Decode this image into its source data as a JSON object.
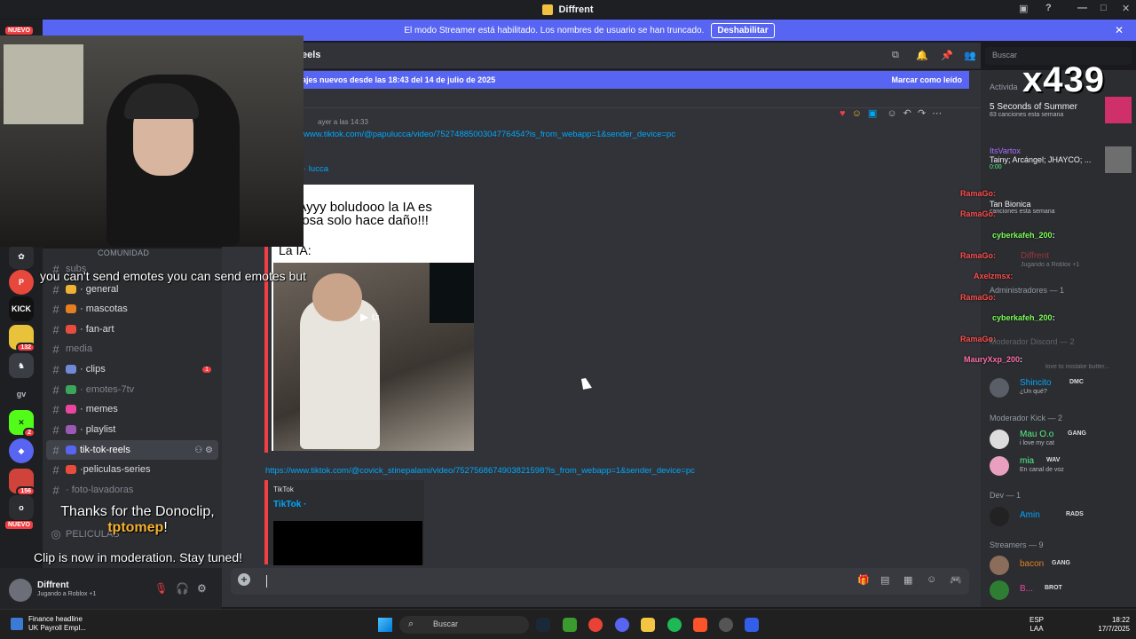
{
  "window": {
    "title": "Diffrent"
  },
  "banner": {
    "text": "El modo Streamer está habilitado. Los nombres de usuario se han truncado.",
    "button": "Deshabilitar"
  },
  "channel_header": {
    "title": "eels",
    "search_placeholder": "Buscar"
  },
  "new_messages_bar": {
    "text": "ajes nuevos desde las 18:43 del 14 de julio de 2025",
    "mark_read": "Marcar como leído"
  },
  "message1": {
    "timestamp": "ayer a las 14:33",
    "link": "www.tiktok.com/@papulucca/video/7527488500304776454?is_from_webapp=1&sender_device=pc",
    "embed_author": "· lucca",
    "meme_caption_line1": "os: Ayyy boludooo la IA es",
    "meme_caption_line2": "eligrosa solo hace daño!!!",
    "meme_label": "La IA:"
  },
  "message2": {
    "link": "https://www.tiktok.com/@covick_stinepalami/video/7527568674903821598?is_from_webapp=1&sender_device=pc",
    "embed_source": "TikTok",
    "embed_title": "TikTok ·"
  },
  "sidebar": {
    "category": "COMUNIDAD",
    "channels": [
      {
        "name": "subs",
        "muted": true
      },
      {
        "name": "· general",
        "muted": false
      },
      {
        "name": "· mascotas",
        "muted": false
      },
      {
        "name": "· fan-art",
        "muted": false
      },
      {
        "name": "media",
        "muted": true
      },
      {
        "name": "· clips",
        "muted": false,
        "badge": "1"
      },
      {
        "name": "· emotes-7tv",
        "muted": true
      },
      {
        "name": "· memes",
        "muted": false
      },
      {
        "name": "· playlist",
        "muted": false
      },
      {
        "name": "tik-tok-reels",
        "muted": false,
        "active": true
      },
      {
        "name": "·peliculas-series",
        "muted": false
      },
      {
        "name": "· foto-lavadoras",
        "muted": true
      },
      {
        "name": "PELICULAS",
        "muted": true
      }
    ]
  },
  "rail": {
    "nuevo_top": "NUEVO",
    "nuevo_bottom": "NUEVO",
    "servers": [
      {
        "label": "KICK",
        "color": "#111111"
      },
      {
        "label": "",
        "color": "#e8c23a",
        "badge": "132"
      },
      {
        "label": "",
        "color": "#3b3d44"
      },
      {
        "label": "gv",
        "color": "#1e1f22"
      },
      {
        "label": "",
        "color": "#53fc18",
        "badge": "2"
      },
      {
        "label": "",
        "color": "#5865f2"
      },
      {
        "label": "",
        "color": "#d0433b",
        "badge": "156"
      },
      {
        "label": "o",
        "color": "#2b2d31"
      }
    ]
  },
  "user_panel": {
    "name": "Diffrent",
    "status": "Jugando a Roblox +1"
  },
  "composer": {
    "placeholder": ""
  },
  "members": {
    "activity_header": "Activida",
    "activities": [
      {
        "title": "5 Seconds of Summer",
        "sub": "83 canciones esta semana"
      },
      {
        "user": "ItsVartox",
        "title": "Tainy; Arcángel; JHAYCO; ...",
        "sub": "0:00"
      },
      {
        "title": "Tan Bionica",
        "sub": "canciones esta semana"
      }
    ],
    "groups": [
      {
        "label": "Administradores — 1"
      },
      {
        "label": "Moderador Kick — 2"
      },
      {
        "label": "Dev — 1"
      },
      {
        "label": "Streamers — 9"
      }
    ],
    "people": [
      {
        "name": "Shincito",
        "tag": "DMC",
        "status": "¿Un qué?",
        "color": "#00a8fc"
      },
      {
        "name": "Mau O.o",
        "tag": "GANG",
        "status": "i love my cat",
        "color": "#57f287"
      },
      {
        "name": "mia",
        "tag": "WAV",
        "status": "En canal de voz",
        "color": "#57f287"
      },
      {
        "name": "Amin",
        "tag": "RADS",
        "status": "",
        "color": "#00a8fc"
      },
      {
        "name": "bacon",
        "tag": "GANG",
        "status": "",
        "color": "#e67e22"
      },
      {
        "name": "B...",
        "tag": "BROT",
        "status": "",
        "color": "#eb459e"
      }
    ]
  },
  "stream_overlay": {
    "emote_message": "you can't send emotes you can send emotes but",
    "donoclip_line1": "Thanks for the Donoclip,",
    "donoclip_user": "tptomep",
    "donoclip_bang": "!",
    "moderation": "Clip is now in moderation. Stay tuned!",
    "counter": "x439",
    "chat": [
      {
        "user": "RamaGo",
        "text": ":",
        "color": "#ff4d4d"
      },
      {
        "user": "RamaGo",
        "text": ":",
        "color": "#ff4d4d"
      },
      {
        "user": "cyberkafeh_200",
        "text": ":",
        "color": "#7dff5a"
      },
      {
        "user": "RamaGo",
        "text": ":",
        "color": "#ff4d4d"
      },
      {
        "user": "Axelzmsx",
        "text": ":",
        "color": "#ff4d4d"
      },
      {
        "user": "RamaGo",
        "text": ":",
        "color": "#ff4d4d"
      },
      {
        "user": "cyberkafeh_200",
        "text": ":",
        "color": "#7dff5a"
      },
      {
        "user": "RamaGo",
        "text": ":",
        "color": "#ff4d4d"
      },
      {
        "user": "MauryXxp_200",
        "text": ":",
        "color": "#ff6fa8"
      }
    ],
    "faded": {
      "diffrent": "Diffrent",
      "diffrent_status": "Jugando a Roblox +1",
      "moderador_discord": "Moderador Discord — 2",
      "love": "love to mistake butter..."
    }
  },
  "taskbar": {
    "news_title": "Finance headline",
    "news_sub": "UK Payroll Empl...",
    "search": "Buscar",
    "lang": "ESP",
    "lang2": "LAA",
    "time": "18:22",
    "date": "17/7/2025"
  },
  "colors": {
    "blurple": "#5865f2",
    "danger": "#f23f43",
    "link": "#00a8fc"
  }
}
